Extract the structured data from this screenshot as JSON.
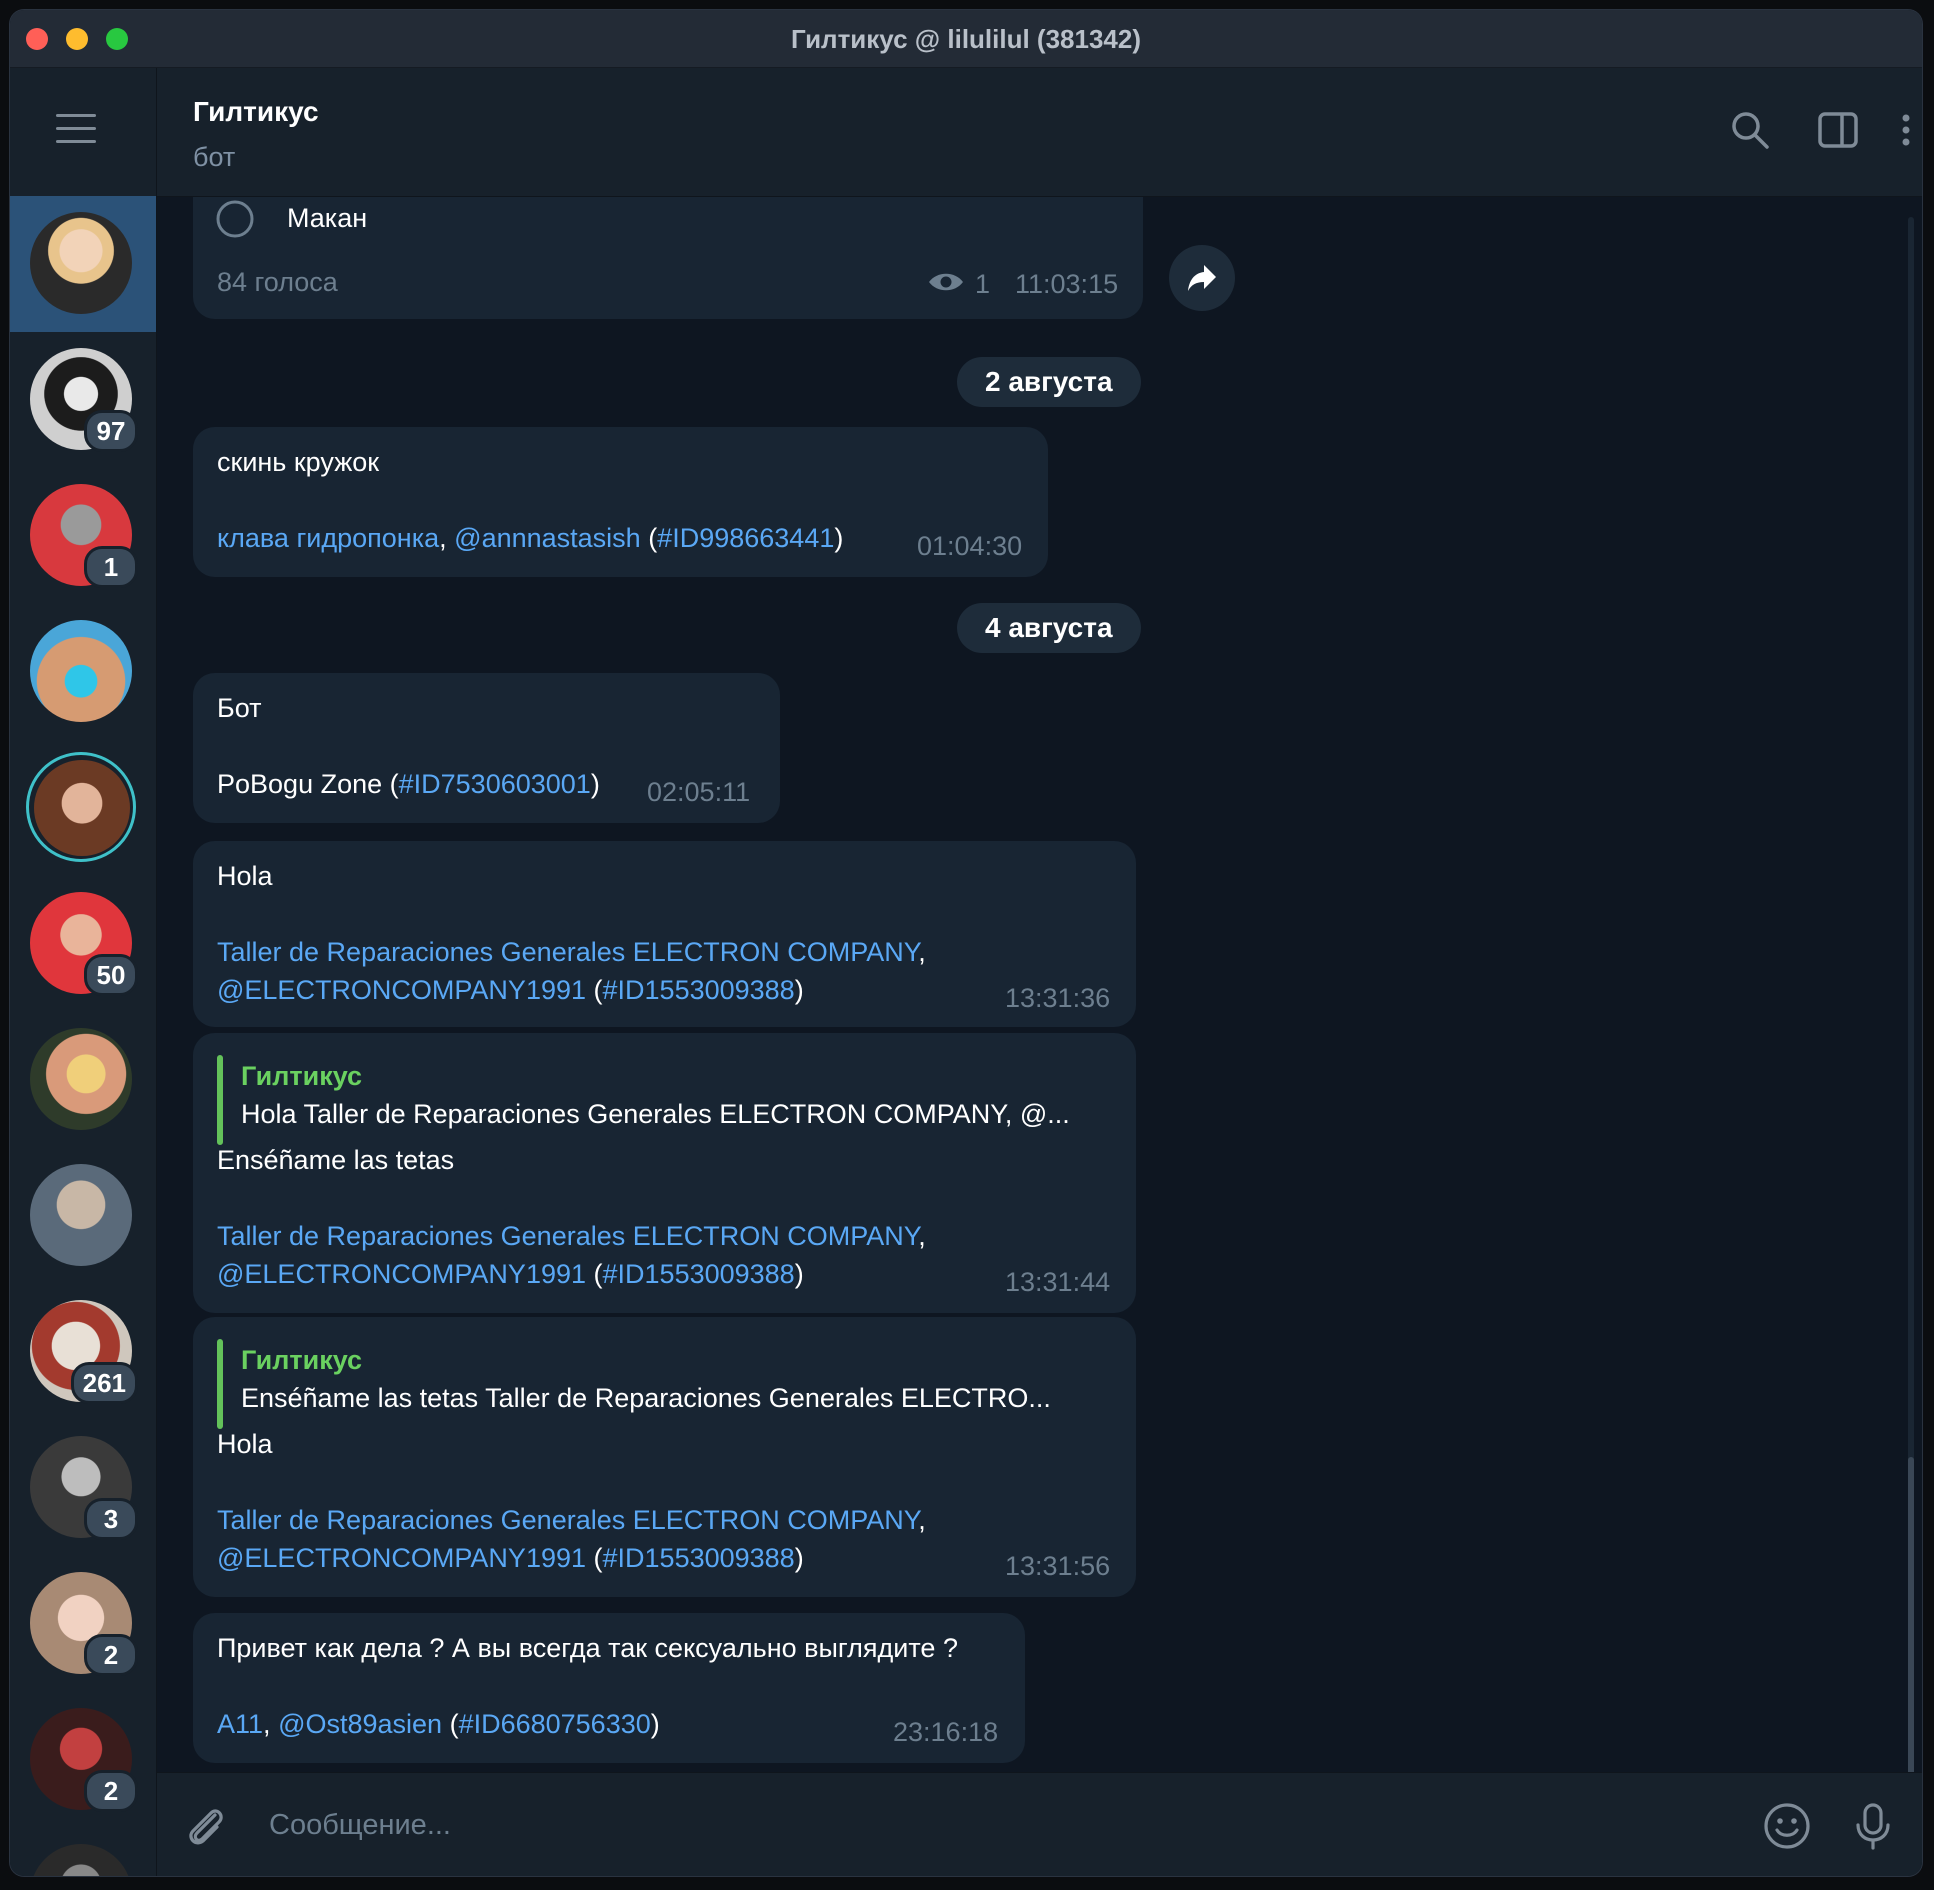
{
  "window": {
    "title": "Гилтикус @ lilulilul (381342)"
  },
  "header": {
    "title": "Гилтикус",
    "subtitle": "бот"
  },
  "sidebar": {
    "chats": [
      {
        "active": true,
        "badge": ""
      },
      {
        "active": false,
        "badge": "97"
      },
      {
        "active": false,
        "badge": "1"
      },
      {
        "active": false,
        "badge": ""
      },
      {
        "active": false,
        "badge": ""
      },
      {
        "active": false,
        "badge": "50"
      },
      {
        "active": false,
        "badge": ""
      },
      {
        "active": false,
        "badge": ""
      },
      {
        "active": false,
        "badge": "261"
      },
      {
        "active": false,
        "badge": "3"
      },
      {
        "active": false,
        "badge": "2"
      },
      {
        "active": false,
        "badge": "2"
      }
    ]
  },
  "poll": {
    "option": "Макан",
    "votes": "84 голоса",
    "views": "1",
    "time": "11:03:15"
  },
  "dates": {
    "d1": "2 августа",
    "d2": "4 августа"
  },
  "messages": {
    "m1": {
      "text": "скинь кружок",
      "l1": "клава гидропонка",
      "sep1": ", ",
      "l2": "@annnastasish",
      "p1": " (",
      "l3": "#ID998663441",
      "p2": ")",
      "time": "01:04:30"
    },
    "m2": {
      "text": "Бот",
      "plain": "PoBogu Zone (",
      "l1": "#ID7530603001",
      "p2": ")",
      "time": "02:05:11"
    },
    "m3": {
      "text": "Hola",
      "l1": "Taller de Reparaciones Generales ELECTRON COMPANY",
      "sep1": ",",
      "l2": "@ELECTRONCOMPANY1991",
      "p1": " (",
      "l3": "#ID1553009388",
      "p2": ")",
      "time": "13:31:36"
    },
    "m4": {
      "reply_name": "Гилтикус",
      "reply_text": "Hola  Taller de Reparaciones Generales ELECTRON COMPANY, @...",
      "text": "Enséñame las tetas",
      "l1": "Taller de Reparaciones Generales ELECTRON COMPANY",
      "sep1": ",",
      "l2": "@ELECTRONCOMPANY1991",
      "p1": " (",
      "l3": "#ID1553009388",
      "p2": ")",
      "time": "13:31:44"
    },
    "m5": {
      "reply_name": "Гилтикус",
      "reply_text": "Enséñame las tetas  Taller de Reparaciones Generales ELECTRO...",
      "text": "Hola",
      "l1": "Taller de Reparaciones Generales ELECTRON COMPANY",
      "sep1": ",",
      "l2": "@ELECTRONCOMPANY1991",
      "p1": " (",
      "l3": "#ID1553009388",
      "p2": ")",
      "time": "13:31:56"
    },
    "m6": {
      "text": "Привет как дела ? А вы всегда так сексуально выглядите ?",
      "l1": "A11",
      "sep1": ", ",
      "l2": "@Ost89asien",
      "p1": " (",
      "l3": "#ID6680756330",
      "p2": ")",
      "time": "23:16:18"
    }
  },
  "composer": {
    "placeholder": "Сообщение..."
  }
}
